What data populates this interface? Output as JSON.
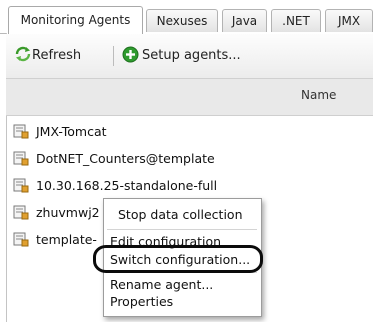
{
  "tabs": [
    {
      "label": "Monitoring Agents",
      "active": true
    },
    {
      "label": "Nexuses",
      "active": false
    },
    {
      "label": "Java",
      "active": false
    },
    {
      "label": ".NET",
      "active": false
    },
    {
      "label": "JMX",
      "active": false
    }
  ],
  "toolbar": {
    "refresh_label": "Refresh",
    "setup_label": "Setup agents...",
    "refresh_icon": "refresh-icon",
    "setup_icon": "plus-circle-icon"
  },
  "table": {
    "column_header": "Name",
    "rows": [
      {
        "name": "JMX-Tomcat",
        "icon": "agent-icon"
      },
      {
        "name": "DotNET_Counters@template",
        "icon": "agent-icon"
      },
      {
        "name": "10.30.168.25-standalone-full",
        "icon": "agent-icon"
      },
      {
        "name": "zhuvmwj2",
        "icon": "agent-icon"
      },
      {
        "name": "template-",
        "icon": "agent-icon"
      }
    ]
  },
  "context_menu": {
    "items": [
      {
        "label": "Stop data collection"
      },
      {
        "label": "Edit configuration"
      },
      {
        "label": "Switch configuration..."
      },
      {
        "label": "Rename agent..."
      },
      {
        "label": "Properties"
      }
    ]
  },
  "colors": {
    "refresh_green": "#3a9a2a",
    "setup_green": "#2e9b2e",
    "header_bg": "#e9e9e9"
  }
}
